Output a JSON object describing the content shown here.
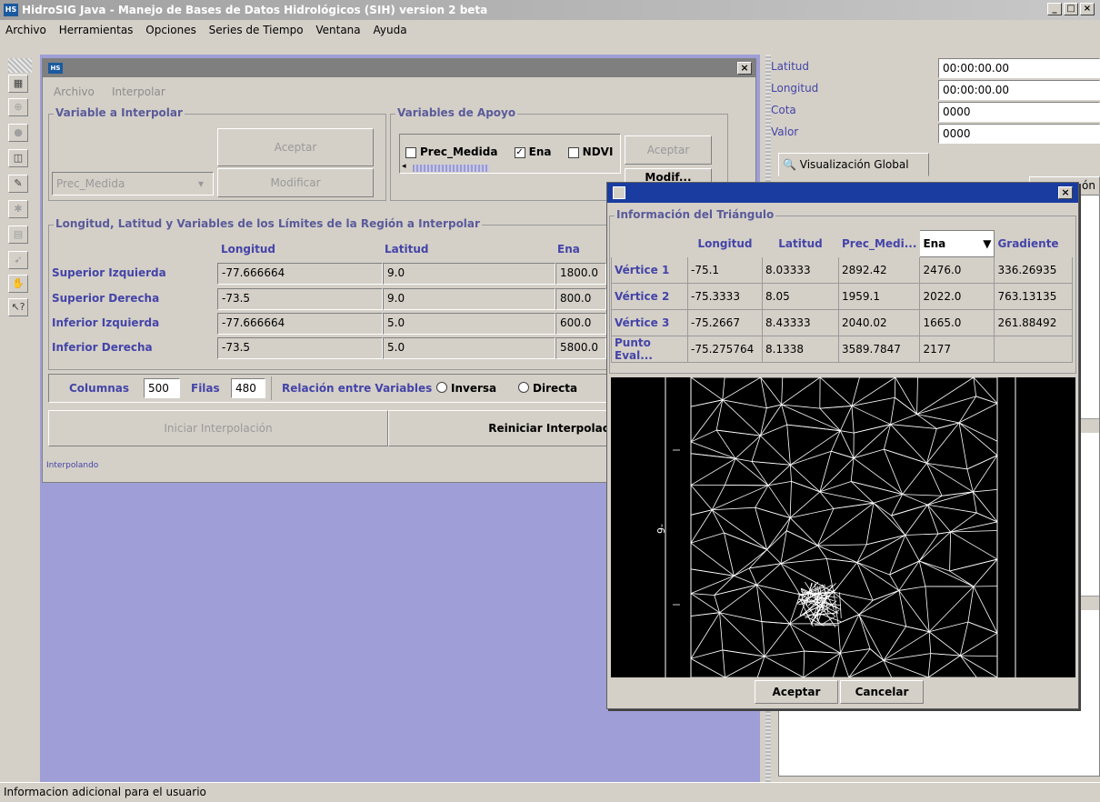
{
  "window": {
    "title": "HidroSIG Java - Manejo de Bases de Datos Hidrológicos (SIH) version 2 beta",
    "logo": "HS"
  },
  "menu": [
    "Archivo",
    "Herramientas",
    "Opciones",
    "Series de Tiempo",
    "Ventana",
    "Ayuda"
  ],
  "interpolar": {
    "menu": [
      "Archivo",
      "Interpolar"
    ],
    "variable_group": "Variable a Interpolar",
    "aceptar": "Aceptar",
    "modificar": "Modificar",
    "combo_value": "Prec_Medida",
    "apoyo_group": "Variables de Apoyo",
    "apoyo_checks": [
      {
        "label": "Prec_Medida",
        "checked": false
      },
      {
        "label": "Ena",
        "checked": true
      },
      {
        "label": "NDVI",
        "checked": false
      }
    ],
    "apoyo_aceptar": "Aceptar",
    "apoyo_modificar": "Modif...",
    "limits_group": "Longitud, Latitud y Variables de los Límites de la Región a Interpolar",
    "limits_headers": [
      "Longitud",
      "Latitud",
      "Ena"
    ],
    "limits_rows": [
      {
        "label": "Superior Izquierda",
        "lon": "-77.666664",
        "lat": "9.0",
        "ena": "1800.0"
      },
      {
        "label": "Superior Derecha",
        "lon": "-73.5",
        "lat": "9.0",
        "ena": "800.0"
      },
      {
        "label": "Inferior Izquierda",
        "lon": "-77.666664",
        "lat": "5.0",
        "ena": "600.0"
      },
      {
        "label": "Inferior Derecha",
        "lon": "-73.5",
        "lat": "5.0",
        "ena": "5800.0"
      }
    ],
    "columnas_label": "Columnas",
    "columnas_value": "500",
    "filas_label": "Filas",
    "filas_value": "480",
    "relacion_label": "Relación entre Variables",
    "inversa": "Inversa",
    "directa": "Directa",
    "iniciar": "Iniciar Interpolación",
    "reiniciar": "Reiniciar Interpolación",
    "status": "Interpolando"
  },
  "right_panel": {
    "fields": [
      {
        "label": "Latitud",
        "value": "00:00:00.00"
      },
      {
        "label": "Longitud",
        "value": "00:00:00.00"
      },
      {
        "label": "Cota",
        "value": "0000"
      },
      {
        "label": "Valor",
        "value": "0000"
      }
    ],
    "tab_global": "Visualización Global",
    "tab_partial": "ón"
  },
  "dialog": {
    "group_title": "Información del Triángulo",
    "headers": [
      "Longitud",
      "Latitud",
      "Prec_Medi...",
      "Ena",
      "Gradiente"
    ],
    "rows": [
      {
        "label": "Vértice 1",
        "lon": "-75.1",
        "lat": "8.03333",
        "prec": "2892.42",
        "ena": "2476.0",
        "grad": "336.26935"
      },
      {
        "label": "Vértice 2",
        "lon": "-75.3333",
        "lat": "8.05",
        "prec": "1959.1",
        "ena": "2022.0",
        "grad": "763.13135"
      },
      {
        "label": "Vértice 3",
        "lon": "-75.2667",
        "lat": "8.43333",
        "prec": "2040.02",
        "ena": "1665.0",
        "grad": "261.88492"
      },
      {
        "label": "Punto Eval...",
        "lon": "-75.275764",
        "lat": "8.1338",
        "prec": "3589.7847",
        "ena": "2177",
        "grad": ""
      }
    ],
    "axis_tick_label": "9-",
    "aceptar": "Aceptar",
    "cancelar": "Cancelar"
  },
  "statusbar": "Informacion adicional para el usuario",
  "colors": {
    "desktop": "#9f9ed6",
    "label_blue": "#4444a8",
    "dialog_title": "#1a3ca0"
  }
}
